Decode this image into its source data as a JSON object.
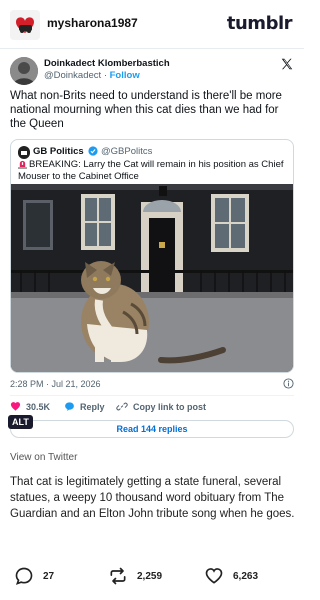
{
  "header": {
    "username": "mysharona1987",
    "brand": "tumblr"
  },
  "tweet": {
    "author_name": "Doinkadect Klomberbastich",
    "author_handle": "@Doinkadect",
    "separator": "·",
    "follow_label": "Follow",
    "text": "What non-Brits need to understand is there'll be more national mourning when this cat dies than we had for the Queen",
    "quote": {
      "name": "GB Politics",
      "handle": "@GBPolitcs",
      "text": "BREAKING: Larry the Cat will remain in his position as Chief Mouser to the Cabinet Office"
    },
    "timestamp": "2:28 PM · Jul 21, 2026",
    "likes": "30.5K",
    "reply_label": "Reply",
    "copy_link_label": "Copy link to post",
    "alt_label": "ALT",
    "read_replies_label": "Read 144 replies"
  },
  "post": {
    "view_on_twitter": "View on Twitter",
    "body": "That cat is legitimately getting a state funeral, several statues, a weepy 10 thousand word obituary from The Guardian and an Elton John tribute song when he goes."
  },
  "footer": {
    "comments": "27",
    "reblogs": "2,259",
    "likes": "6,263"
  },
  "colors": {
    "twitter_blue": "#1d9bf0",
    "like_pink": "#f91880",
    "link_blue": "#006fd6"
  }
}
